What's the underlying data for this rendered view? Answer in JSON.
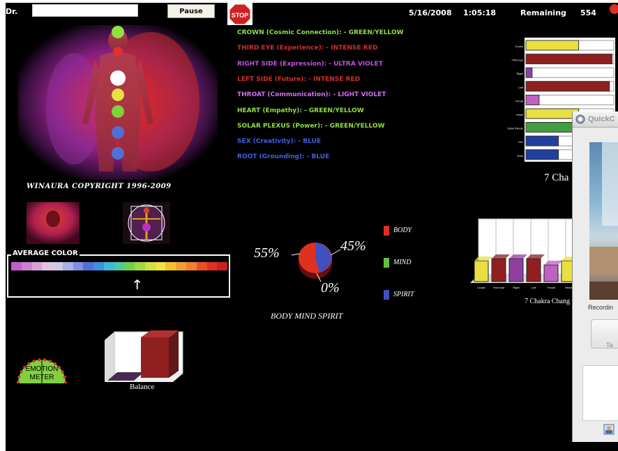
{
  "topbar": {
    "dr_label": "Dr.",
    "dr_input_value": "",
    "pause_label": "Pause",
    "stop_label": "STOP",
    "date": "5/16/2008",
    "time": "1:05:18",
    "remaining_label": "Remaining",
    "remaining_value": "554"
  },
  "aura": {
    "copyright": "WINAURA  COPYRIGHT 1996-2009"
  },
  "chakras": [
    {
      "text": "CROWN (Cosmic Connection): - GREEN/YELLOW",
      "color": "#8ee040"
    },
    {
      "text": "THIRD EYE (Experience):  - INTENSE RED",
      "color": "#d03030"
    },
    {
      "text": "RIGHT SIDE (Expression): - ULTRA VIOLET",
      "color": "#c050e0"
    },
    {
      "text": "LEFT SIDE (Future):  - INTENSE RED",
      "color": "#d03030"
    },
    {
      "text": "THROAT (Communication):  - LIGHT VIOLET",
      "color": "#d070f0"
    },
    {
      "text": "HEART (Empathy): - GREEN/YELLOW",
      "color": "#8ee040"
    },
    {
      "text": "SOLAR PLEXUS (Power): - GREEN/YELLOW",
      "color": "#8ee040"
    },
    {
      "text": "SEX (Creativity): - BLUE",
      "color": "#4060e0"
    },
    {
      "text": "ROOT (Grounding): - BLUE",
      "color": "#4060e0"
    }
  ],
  "average_color": {
    "label": "AVERAGE COLOR",
    "strip": [
      "#c060c8",
      "#c880d0",
      "#d8a0d8",
      "#e0c0e0",
      "#d0c8e8",
      "#a8b0e8",
      "#8090e0",
      "#5070d8",
      "#4090e0",
      "#40b8d8",
      "#50c8a0",
      "#70d050",
      "#a0d840",
      "#d0e040",
      "#f0e040",
      "#f0c030",
      "#f0a030",
      "#f08030",
      "#e85028",
      "#e03020",
      "#c82020"
    ],
    "arrow": "🡑"
  },
  "emotion_meter": {
    "line1": "EMOTION",
    "line2": "METER"
  },
  "balance": {
    "label": "Balance"
  },
  "pie": {
    "title": "BODY MIND SPIRIT",
    "body_pct": "55%",
    "spirit_pct": "45%",
    "mind_pct": "0%",
    "legend": [
      {
        "label": "BODY",
        "color": "#e03020"
      },
      {
        "label": "MIND",
        "color": "#60c040"
      },
      {
        "label": "SPIRIT",
        "color": "#4050c0"
      }
    ]
  },
  "chart_data": [
    {
      "type": "bar",
      "title": "7 Cha",
      "orientation": "horizontal",
      "categories": [
        "Crown",
        "Third eye",
        "Right",
        "Left",
        "Throat",
        "Heart",
        "Solar Plexus",
        "Sex",
        "Root"
      ],
      "values": [
        0.6,
        0.98,
        0.07,
        0.95,
        0.15,
        0.6,
        0.62,
        0.37,
        0.37
      ],
      "colors": [
        "#e8e040",
        "#902020",
        "#9040a0",
        "#902020",
        "#c060c0",
        "#e8e040",
        "#40a040",
        "#2040a0",
        "#2040a0"
      ]
    },
    {
      "type": "bar",
      "title": "7 Chakra Chang",
      "categories": [
        "Crown",
        "Third eye",
        "Right",
        "Left",
        "Throat",
        "Heart"
      ],
      "values": [
        0.5,
        0.55,
        0.55,
        0.55,
        0.4,
        0.5
      ],
      "colors": [
        "#e8e040",
        "#902020",
        "#9040a0",
        "#902020",
        "#c060c0",
        "#e8e040"
      ]
    }
  ],
  "quicktime": {
    "title": "QuickC",
    "recording": "Recordin",
    "tab_label": "Ta"
  }
}
